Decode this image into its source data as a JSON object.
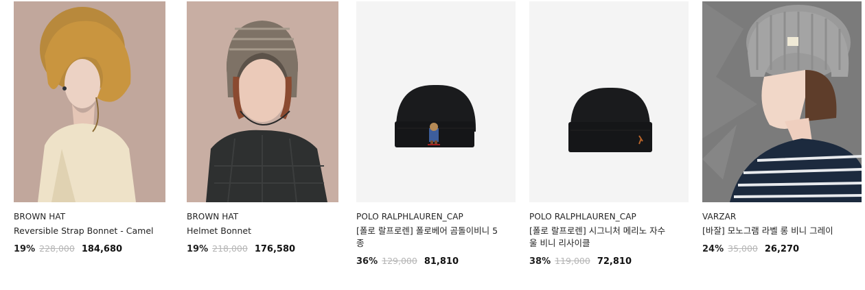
{
  "products": [
    {
      "brand": "BROWN HAT",
      "name": "Reversible Strap Bonnet - Camel",
      "discount": "19%",
      "original_price": "228,000",
      "sale_price": "184,680",
      "image_icon": "camel-bonnet-photo"
    },
    {
      "brand": "BROWN HAT",
      "name": "Helmet Bonnet",
      "discount": "19%",
      "original_price": "218,000",
      "sale_price": "176,580",
      "image_icon": "tweed-helmet-bonnet-photo"
    },
    {
      "brand": "POLO RALPHLAUREN_CAP",
      "name": "[폴로 랄프로렌] 폴로베어 곰돌이비니 5종",
      "discount": "36%",
      "original_price": "129,000",
      "sale_price": "81,810",
      "image_icon": "black-beanie-bear-photo"
    },
    {
      "brand": "POLO RALPHLAUREN_CAP",
      "name": "[폴로 랄프로렌] 시그니처 메리노 자수 울 비니 리사이클",
      "discount": "38%",
      "original_price": "119,000",
      "sale_price": "72,810",
      "image_icon": "black-beanie-pony-photo"
    },
    {
      "brand": "VARZAR",
      "name": "[바잘] 모노그램 라벨 롱 비니 그레이",
      "discount": "24%",
      "original_price": "35,000",
      "sale_price": "26,270",
      "image_icon": "grey-beanie-model-photo"
    }
  ]
}
